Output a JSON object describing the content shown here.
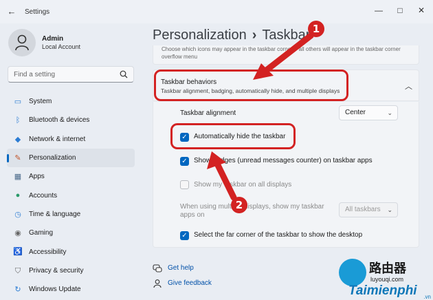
{
  "window": {
    "title": "Settings",
    "back_glyph": "←",
    "minimize_glyph": "—",
    "maximize_glyph": "□",
    "close_glyph": "✕"
  },
  "user": {
    "name": "Admin",
    "account_type": "Local Account"
  },
  "search": {
    "placeholder": "Find a setting"
  },
  "sidebar": {
    "items": [
      {
        "label": "System",
        "icon": "system-icon",
        "glyph": "▭",
        "color": "#2b7cd3"
      },
      {
        "label": "Bluetooth & devices",
        "icon": "bluetooth-icon",
        "glyph": "ᛒ",
        "color": "#2b7cd3"
      },
      {
        "label": "Network & internet",
        "icon": "network-icon",
        "glyph": "◆",
        "color": "#2b7cd3"
      },
      {
        "label": "Personalization",
        "icon": "brush-icon",
        "glyph": "✎",
        "color": "#c0552b",
        "selected": true
      },
      {
        "label": "Apps",
        "icon": "apps-icon",
        "glyph": "▦",
        "color": "#4a6a8a"
      },
      {
        "label": "Accounts",
        "icon": "accounts-icon",
        "glyph": "●",
        "color": "#2a9a6a"
      },
      {
        "label": "Time & language",
        "icon": "time-language-icon",
        "glyph": "◷",
        "color": "#2b7cd3"
      },
      {
        "label": "Gaming",
        "icon": "gaming-icon",
        "glyph": "◉",
        "color": "#666666"
      },
      {
        "label": "Accessibility",
        "icon": "accessibility-icon",
        "glyph": "♿",
        "color": "#2b7cd3"
      },
      {
        "label": "Privacy & security",
        "icon": "shield-icon",
        "glyph": "⛉",
        "color": "#666666"
      },
      {
        "label": "Windows Update",
        "icon": "windows-update-icon",
        "glyph": "↻",
        "color": "#2b7cd3"
      }
    ]
  },
  "breadcrumb": {
    "parent": "Personalization",
    "separator": "›",
    "current": "Taskbar"
  },
  "overflow_card": {
    "text": "Choose which icons may appear in the taskbar corner – all others will appear in the taskbar corner overflow menu"
  },
  "behaviors": {
    "title": "Taskbar behaviors",
    "subtitle": "Taskbar alignment, badging, automatically hide, and multiple displays",
    "collapse_glyph": "︿",
    "alignment_label": "Taskbar alignment",
    "alignment_value": "Center",
    "auto_hide_label": "Automatically hide the taskbar",
    "auto_hide_checked": true,
    "badges_label": "Show badges (unread messages counter) on taskbar apps",
    "badges_checked": true,
    "all_displays_label": "Show my taskbar on all displays",
    "all_displays_checked": false,
    "multi_display_label": "When using multiple displays, show my taskbar apps on",
    "multi_display_value": "All taskbars",
    "far_corner_label": "Select the far corner of the taskbar to show the desktop",
    "far_corner_checked": true,
    "dropdown_glyph": "⌄",
    "check_glyph": "✓"
  },
  "links": {
    "help": "Get help",
    "feedback": "Give feedback"
  },
  "annotations": {
    "badge_1": "1",
    "badge_2": "2",
    "color": "#d32222"
  },
  "watermark": {
    "chinese": "路由器",
    "url": "luyouqi.com",
    "brand": "Taimienphi",
    "suffix": ".vn"
  }
}
